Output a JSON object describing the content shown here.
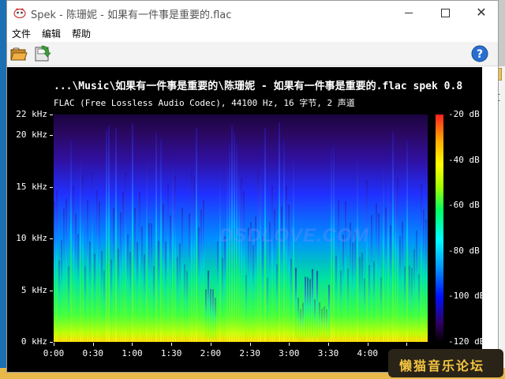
{
  "window": {
    "title": "Spek - 陈珊妮 - 如果有一件事是重要的.flac",
    "controls": {
      "minimize": "minimize",
      "maximize": "maximize",
      "close": "✕"
    }
  },
  "menu": {
    "items": [
      "文件",
      "编辑",
      "帮助"
    ]
  },
  "toolbar": {
    "open_icon": "folder-open-icon",
    "save_icon": "save-icon",
    "help_icon": "help-icon"
  },
  "spek": {
    "title": "...\\Music\\如果有一件事是重要的\\陈珊妮 - 如果有一件事是重要的.flac spek 0.8",
    "subtitle": "FLAC (Free Lossless Audio Codec), 44100 Hz, 16 字节, 2 声道",
    "watermark": "DSDLOVE.COM"
  },
  "chart_data": {
    "type": "heatmap",
    "title": "",
    "xlabel": "",
    "ylabel": "",
    "y_ticks": [
      "22 kHz",
      "20 kHz",
      "15 kHz",
      "10 kHz",
      "5 kHz",
      "0 kHz"
    ],
    "y_tick_values": [
      22,
      20,
      15,
      10,
      5,
      0
    ],
    "x_ticks": [
      "0:00",
      "0:30",
      "1:00",
      "1:30",
      "2:00",
      "2:30",
      "3:00",
      "3:30",
      "4:00",
      "4:30"
    ],
    "x_tick_values": [
      0,
      30,
      60,
      90,
      120,
      150,
      180,
      210,
      240,
      270
    ],
    "xlim": [
      0,
      286
    ],
    "ylim": [
      0,
      22
    ],
    "colorbar_ticks": [
      "-20 dB",
      "-40 dB",
      "-60 dB",
      "-80 dB",
      "-100 dB",
      "-120 dB"
    ],
    "colorbar_values": [
      -20,
      -40,
      -60,
      -80,
      -100,
      -120
    ]
  },
  "overlay": {
    "badge": "懒猫音乐论坛"
  },
  "desktop": {
    "right_text": "文"
  }
}
